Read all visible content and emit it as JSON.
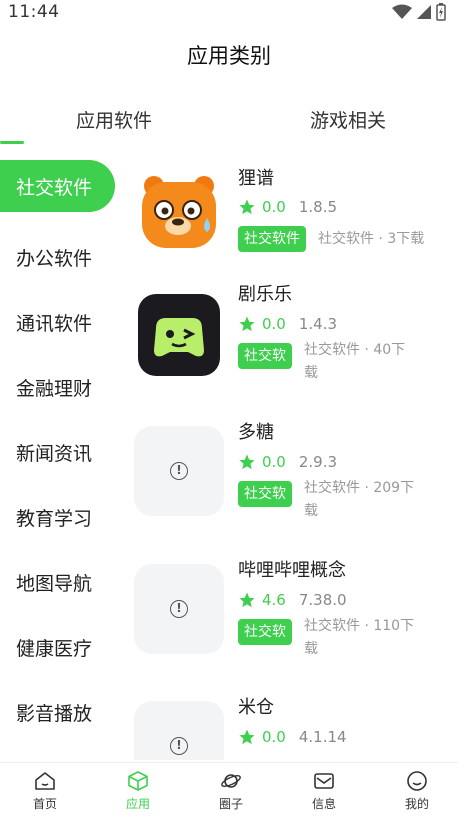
{
  "status": {
    "time": "11:44"
  },
  "page_title": "应用类别",
  "tabs": [
    {
      "label": "应用软件"
    },
    {
      "label": "游戏相关"
    }
  ],
  "sidebar": {
    "items": [
      {
        "label": "社交软件"
      },
      {
        "label": "办公软件"
      },
      {
        "label": "通讯软件"
      },
      {
        "label": "金融理财"
      },
      {
        "label": "新闻资讯"
      },
      {
        "label": "教育学习"
      },
      {
        "label": "地图导航"
      },
      {
        "label": "健康医疗"
      },
      {
        "label": "影音播放"
      }
    ]
  },
  "apps": [
    {
      "name": "狸谱",
      "rating": "0.0",
      "version": "1.8.5",
      "tag": "社交软件",
      "desc": "社交软件 · 3下载"
    },
    {
      "name": "剧乐乐",
      "rating": "0.0",
      "version": "1.4.3",
      "tag": "社交软",
      "desc_line1": "社交软件 · 40下",
      "desc_line2": "载"
    },
    {
      "name": "多糖",
      "rating": "0.0",
      "version": "2.9.3",
      "tag": "社交软",
      "desc_line1": "社交软件 · 209下",
      "desc_line2": "载"
    },
    {
      "name": "哔哩哔哩概念",
      "rating": "4.6",
      "version": "7.38.0",
      "tag": "社交软",
      "desc_line1": "社交软件 · 110下",
      "desc_line2": "载"
    },
    {
      "name": "米仓",
      "rating": "0.0",
      "version": "4.1.14"
    }
  ],
  "bottom_nav": [
    {
      "label": "首页",
      "icon": "home-icon"
    },
    {
      "label": "应用",
      "icon": "cube-icon",
      "active": true
    },
    {
      "label": "圈子",
      "icon": "planet-icon"
    },
    {
      "label": "信息",
      "icon": "mail-icon"
    },
    {
      "label": "我的",
      "icon": "smile-icon"
    }
  ],
  "colors": {
    "accent": "#3fcf4e"
  }
}
